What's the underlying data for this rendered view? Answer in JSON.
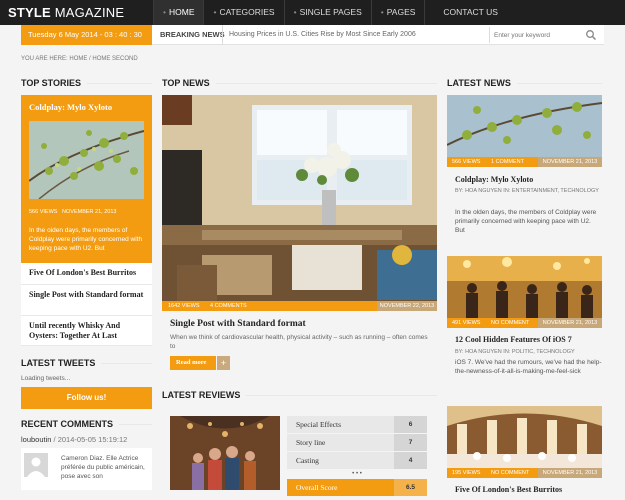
{
  "header": {
    "logo_bold": "STYLE",
    "logo_rest": " MAGAZINE",
    "nav": [
      "HOME",
      "CATEGORIES",
      "SINGLE PAGES",
      "PAGES",
      "CONTACT US"
    ]
  },
  "subbar": {
    "date": "Tuesday 6 May 2014 - 03 : 40 : 30",
    "breaking_label": "BREAKING NEWS",
    "breaking_text": "Housing Prices in U.S. Cities Rise by Most Since Early 2006",
    "search_placeholder": "Enter your keyword"
  },
  "breadcrumb": {
    "prefix": "YOU ARE HERE:",
    "home": "HOME",
    "sep": "/",
    "current": "HOME SECOND"
  },
  "top_stories": {
    "heading": "TOP STORIES",
    "featured": {
      "title": "Coldplay: Mylo Xyloto",
      "views": "566 VIEWS",
      "date": "NOVEMBER 21, 2013",
      "excerpt": "In the olden days, the members of Coldplay were primarily concerned with keeping pace with U2. But"
    },
    "links": [
      "Five Of London's Best Burritos",
      "Single Post with Standard format",
      "Until recently Whisky And Oysters: Together At Last"
    ]
  },
  "latest_tweets": {
    "heading": "LATEST TWEETS",
    "loading": "Loading tweets...",
    "follow": "Follow us!"
  },
  "recent_comments": {
    "heading": "RECENT COMMENTS",
    "author": "louboutin",
    "date": "/ 2014-05-05 15:19:12",
    "text": "Cameron Diaz. Elle Actrice préférée du public américain, pose avec son"
  },
  "top_news": {
    "heading": "TOP NEWS",
    "views": "1642 VIEWS",
    "comments": "4 COMMENTS",
    "date": "NOVEMBER 22, 2013",
    "title": "Single Post with Standard format",
    "excerpt": "When we think of cardiovascular health, physical activity – such as running – often comes to",
    "read_more": "Read more",
    "plus": "+"
  },
  "latest_reviews": {
    "heading": "LATEST REVIEWS",
    "rows": [
      {
        "label": "Special Effects",
        "score": "6"
      },
      {
        "label": "Story line",
        "score": "7"
      },
      {
        "label": "Casting",
        "score": "4"
      }
    ],
    "more": "• • •",
    "overall_label": "Overall Score",
    "overall_score": "6.5"
  },
  "latest_news": {
    "heading": "LATEST NEWS",
    "items": [
      {
        "views": "566 VIEWS",
        "comments": "1 COMMENT",
        "date": "NOVEMBER 21, 2013",
        "title": "Coldplay: Mylo Xyloto",
        "byline": "BY: HOA NGUYEN   IN: ENTERTAINMENT, TECHNOLOGY",
        "excerpt": "In the olden days, the members of Coldplay were primarily concerned with keeping pace with U2. But"
      },
      {
        "views": "491 VIEWS",
        "comments": "NO COMMENT",
        "date": "NOVEMBER 21, 2013",
        "title": "12 Cool Hidden Features Of iOS 7",
        "byline": "BY: HOA NGUYEN   IN: POLITIC, TECHNOLOGY",
        "excerpt": "iOS 7. We've had the rumours, we've had the help-the-newness-of-it-all-is-making-me-feel-sick"
      },
      {
        "views": "195 VIEWS",
        "comments": "NO COMMENT",
        "date": "NOVEMBER 21, 2013",
        "title": "Five Of London's Best Burritos"
      }
    ]
  },
  "colors": {
    "accent": "#f39c12",
    "header_bg": "#1f1f1f",
    "page_bg": "#f4f4f4"
  }
}
